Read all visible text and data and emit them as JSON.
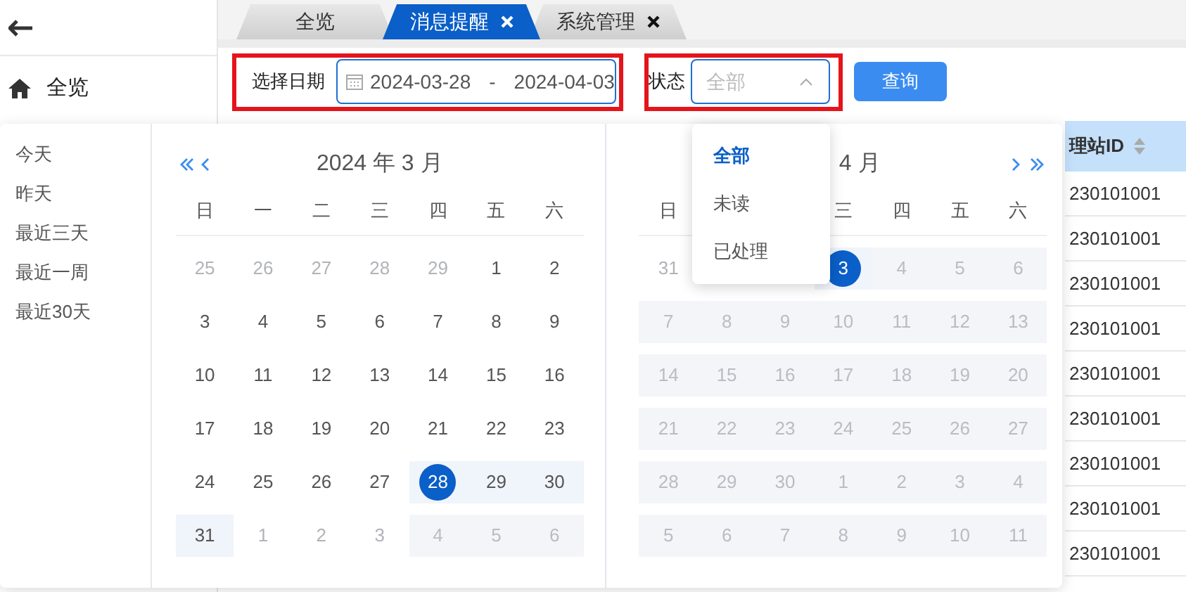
{
  "sidebar": {
    "items": [
      {
        "label": "全览"
      }
    ]
  },
  "tabs": [
    {
      "label": "全览",
      "selected": false,
      "closable": false
    },
    {
      "label": "消息提醒",
      "selected": true,
      "closable": true
    },
    {
      "label": "系统管理",
      "selected": false,
      "closable": true
    }
  ],
  "filters": {
    "date_label": "选择日期",
    "date_start": "2024-03-28",
    "date_separator": "-",
    "date_end": "2024-04-03",
    "status_label": "状态",
    "status_placeholder": "全部",
    "query_button": "查询"
  },
  "date_picker": {
    "shortcuts": [
      "今天",
      "昨天",
      "最近三天",
      "最近一周",
      "最近30天"
    ],
    "panels": [
      {
        "title": "2024 年 3 月",
        "has_prev": true,
        "weekdays": [
          {
            "kind": "label",
            "label": "日"
          },
          {
            "kind": "label",
            "label": "一"
          },
          {
            "kind": "label",
            "label": "二"
          },
          {
            "kind": "label",
            "label": "三"
          },
          {
            "kind": "label",
            "label": "四"
          },
          {
            "kind": "label",
            "label": "五"
          },
          {
            "kind": "label",
            "label": "六"
          }
        ],
        "rows": [
          [
            {
              "d": "25",
              "kind": "other"
            },
            {
              "d": "26",
              "kind": "other"
            },
            {
              "d": "27",
              "kind": "other"
            },
            {
              "d": "28",
              "kind": "other"
            },
            {
              "d": "29",
              "kind": "other"
            },
            {
              "d": "1",
              "kind": "day"
            },
            {
              "d": "2",
              "kind": "day"
            }
          ],
          [
            {
              "d": "3",
              "kind": "day"
            },
            {
              "d": "4",
              "kind": "day"
            },
            {
              "d": "5",
              "kind": "day"
            },
            {
              "d": "6",
              "kind": "day"
            },
            {
              "d": "7",
              "kind": "day"
            },
            {
              "d": "8",
              "kind": "day"
            },
            {
              "d": "9",
              "kind": "day"
            }
          ],
          [
            {
              "d": "10",
              "kind": "day"
            },
            {
              "d": "11",
              "kind": "day"
            },
            {
              "d": "12",
              "kind": "day"
            },
            {
              "d": "13",
              "kind": "day"
            },
            {
              "d": "14",
              "kind": "day"
            },
            {
              "d": "15",
              "kind": "day"
            },
            {
              "d": "16",
              "kind": "day"
            }
          ],
          [
            {
              "d": "17",
              "kind": "day"
            },
            {
              "d": "18",
              "kind": "day"
            },
            {
              "d": "19",
              "kind": "day"
            },
            {
              "d": "20",
              "kind": "day"
            },
            {
              "d": "21",
              "kind": "day"
            },
            {
              "d": "22",
              "kind": "day"
            },
            {
              "d": "23",
              "kind": "day"
            }
          ],
          [
            {
              "d": "24",
              "kind": "day"
            },
            {
              "d": "25",
              "kind": "day"
            },
            {
              "d": "26",
              "kind": "day"
            },
            {
              "d": "27",
              "kind": "day"
            },
            {
              "d": "28",
              "kind": "start"
            },
            {
              "d": "29",
              "kind": "range"
            },
            {
              "d": "30",
              "kind": "range"
            }
          ],
          [
            {
              "d": "31",
              "kind": "range"
            },
            {
              "d": "1",
              "kind": "other"
            },
            {
              "d": "2",
              "kind": "other"
            },
            {
              "d": "3",
              "kind": "other"
            },
            {
              "d": "4",
              "kind": "disabled"
            },
            {
              "d": "5",
              "kind": "disabled"
            },
            {
              "d": "6",
              "kind": "disabled"
            }
          ]
        ]
      },
      {
        "title": "4 月",
        "has_next": true,
        "weekdays": [
          {
            "kind": "label",
            "label": "日"
          },
          {
            "kind": "covered"
          },
          {
            "kind": "covered"
          },
          {
            "kind": "label",
            "label": "三"
          },
          {
            "kind": "label",
            "label": "四"
          },
          {
            "kind": "label",
            "label": "五"
          },
          {
            "kind": "label",
            "label": "六"
          }
        ],
        "rows": [
          [
            {
              "d": "31",
              "kind": "other"
            },
            {
              "kind": "covered"
            },
            {
              "kind": "covered"
            },
            {
              "d": "3",
              "kind": "end"
            },
            {
              "d": "4",
              "kind": "disabled"
            },
            {
              "d": "5",
              "kind": "disabled"
            },
            {
              "d": "6",
              "kind": "disabled"
            }
          ],
          [
            {
              "d": "7",
              "kind": "disabled"
            },
            {
              "d": "8",
              "kind": "disabled"
            },
            {
              "d": "9",
              "kind": "disabled"
            },
            {
              "d": "10",
              "kind": "disabled"
            },
            {
              "d": "11",
              "kind": "disabled"
            },
            {
              "d": "12",
              "kind": "disabled"
            },
            {
              "d": "13",
              "kind": "disabled"
            }
          ],
          [
            {
              "d": "14",
              "kind": "disabled"
            },
            {
              "d": "15",
              "kind": "disabled"
            },
            {
              "d": "16",
              "kind": "disabled"
            },
            {
              "d": "17",
              "kind": "disabled"
            },
            {
              "d": "18",
              "kind": "disabled"
            },
            {
              "d": "19",
              "kind": "disabled"
            },
            {
              "d": "20",
              "kind": "disabled"
            }
          ],
          [
            {
              "d": "21",
              "kind": "disabled"
            },
            {
              "d": "22",
              "kind": "disabled"
            },
            {
              "d": "23",
              "kind": "disabled"
            },
            {
              "d": "24",
              "kind": "disabled"
            },
            {
              "d": "25",
              "kind": "disabled"
            },
            {
              "d": "26",
              "kind": "disabled"
            },
            {
              "d": "27",
              "kind": "disabled"
            }
          ],
          [
            {
              "d": "28",
              "kind": "disabled"
            },
            {
              "d": "29",
              "kind": "disabled"
            },
            {
              "d": "30",
              "kind": "disabled"
            },
            {
              "d": "1",
              "kind": "disabled"
            },
            {
              "d": "2",
              "kind": "disabled"
            },
            {
              "d": "3",
              "kind": "disabled"
            },
            {
              "d": "4",
              "kind": "disabled"
            }
          ],
          [
            {
              "d": "5",
              "kind": "disabled"
            },
            {
              "d": "6",
              "kind": "disabled"
            },
            {
              "d": "7",
              "kind": "disabled"
            },
            {
              "d": "8",
              "kind": "disabled"
            },
            {
              "d": "9",
              "kind": "disabled"
            },
            {
              "d": "10",
              "kind": "disabled"
            },
            {
              "d": "11",
              "kind": "disabled"
            }
          ]
        ]
      }
    ]
  },
  "status_dropdown": {
    "options": [
      {
        "label": "全部",
        "selected": true
      },
      {
        "label": "未读",
        "selected": false
      },
      {
        "label": "已处理",
        "selected": false
      }
    ]
  },
  "table": {
    "columns": [
      {
        "label": "理站ID",
        "sortable": true
      }
    ],
    "rows": [
      [
        "230101001"
      ],
      [
        "230101001"
      ],
      [
        "230101001"
      ],
      [
        "230101001"
      ],
      [
        "230101001"
      ],
      [
        "230101001"
      ],
      [
        "230101001"
      ],
      [
        "230101001"
      ],
      [
        "230101001"
      ]
    ]
  }
}
